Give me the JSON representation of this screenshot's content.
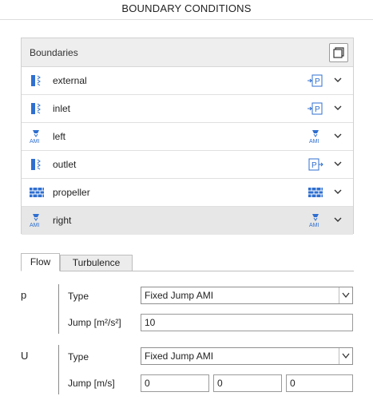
{
  "panel_title": "BOUNDARY CONDITIONS",
  "boundaries": {
    "header": "Boundaries",
    "items": [
      {
        "name": "external",
        "left_icon": "patch-icon",
        "right_icon": "pressure-patch-icon"
      },
      {
        "name": "inlet",
        "left_icon": "patch-icon",
        "right_icon": "pressure-patch-icon"
      },
      {
        "name": "left",
        "left_icon": "ami-icon",
        "right_icon": "ami-icon"
      },
      {
        "name": "outlet",
        "left_icon": "patch-icon",
        "right_icon": "pressure-outlet-icon"
      },
      {
        "name": "propeller",
        "left_icon": "wall-icon",
        "right_icon": "wall-icon"
      },
      {
        "name": "right",
        "left_icon": "ami-icon",
        "right_icon": "ami-icon",
        "selected": true
      }
    ]
  },
  "tabs": [
    {
      "label": "Flow",
      "active": true
    },
    {
      "label": "Turbulence",
      "active": false
    }
  ],
  "fields": {
    "p": {
      "label": "p",
      "type_label": "Type",
      "type_value": "Fixed Jump AMI",
      "jump_label": "Jump [m²/s²]",
      "jump_value": "10"
    },
    "U": {
      "label": "U",
      "type_label": "Type",
      "type_value": "Fixed Jump AMI",
      "jump_label": "Jump [m/s]",
      "jump_values": [
        "0",
        "0",
        "0"
      ]
    }
  },
  "colors": {
    "icon_blue": "#2f6fd0",
    "selected_row": "#e7e7e7",
    "header_bg": "#eeeeee"
  }
}
